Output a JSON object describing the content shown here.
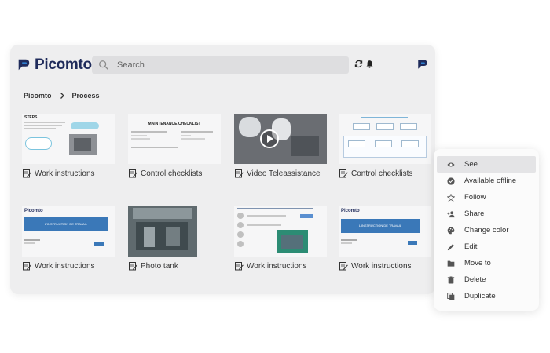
{
  "app": {
    "name": "Picomto",
    "accent": "#2d7fcf",
    "brand": "#1f2b5b"
  },
  "search": {
    "placeholder": "Search"
  },
  "breadcrumb": [
    {
      "label": "Picomto"
    },
    {
      "label": "Process"
    }
  ],
  "tiles": [
    {
      "label": "Work instructions",
      "thumb_heading": "STEPS"
    },
    {
      "label": "Control checklists",
      "thumb_heading": "MAINTENANCE CHECKLIST"
    },
    {
      "label": "Video Teleassistance"
    },
    {
      "label": "Control checklists"
    },
    {
      "label": "Work instructions",
      "thumb_brand": "Picomto",
      "thumb_banner": "L'INSTRUCTION DE TRAVAIL"
    },
    {
      "label": "Photo tank"
    },
    {
      "label": "Work instructions"
    },
    {
      "label": "Work instructions",
      "thumb_brand": "Picomto",
      "thumb_banner": "L'INSTRUCTION DE TRAVAIL"
    }
  ],
  "context_menu": [
    {
      "label": "See",
      "icon": "eye-icon",
      "active": true
    },
    {
      "label": "Available offline",
      "icon": "offline-check-icon"
    },
    {
      "label": "Follow",
      "icon": "star-icon"
    },
    {
      "label": "Share",
      "icon": "share-user-icon"
    },
    {
      "label": "Change color",
      "icon": "palette-icon"
    },
    {
      "label": "Edit",
      "icon": "pencil-icon"
    },
    {
      "label": "Move to",
      "icon": "folder-icon"
    },
    {
      "label": "Delete",
      "icon": "trash-icon"
    },
    {
      "label": "Duplicate",
      "icon": "duplicate-icon"
    }
  ]
}
